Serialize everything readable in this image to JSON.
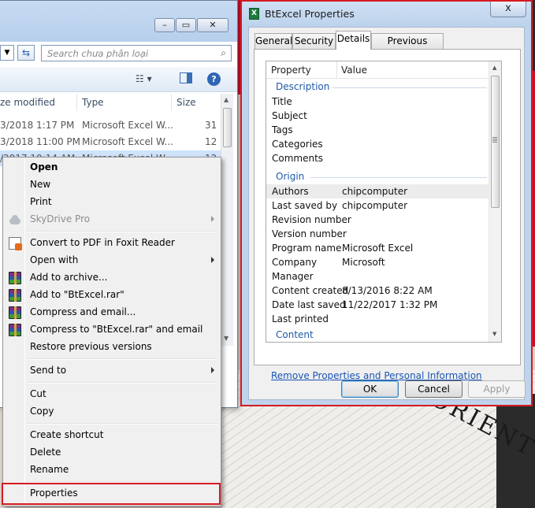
{
  "explorer": {
    "search_placeholder": "Search chưa phân loại",
    "columns": {
      "date": "ze modified",
      "type": "Type",
      "size": "Size"
    },
    "rows": [
      {
        "date": "3/2018 1:17 PM",
        "type": "Microsoft Excel W...",
        "size": "31 I"
      },
      {
        "date": "3/2018 11:00 PM",
        "type": "Microsoft Excel W...",
        "size": "12 I"
      },
      {
        "date": "/2017 10:14 AM",
        "type": "Microsoft Excel W...",
        "size": "12 I"
      }
    ]
  },
  "context_menu": {
    "items": {
      "open": "Open",
      "new": "New",
      "print": "Print",
      "skydrive": "SkyDrive Pro",
      "convert_pdf": "Convert to PDF in Foxit Reader",
      "open_with": "Open with",
      "add_archive": "Add to archive...",
      "add_rar": "Add to \"BtExcel.rar\"",
      "compress_email": "Compress and email...",
      "compress_rar_email": "Compress to \"BtExcel.rar\" and email",
      "restore": "Restore previous versions",
      "send_to": "Send to",
      "cut": "Cut",
      "copy": "Copy",
      "create_shortcut": "Create shortcut",
      "delete": "Delete",
      "rename": "Rename",
      "properties": "Properties"
    }
  },
  "dialog": {
    "title": "BtExcel Properties",
    "close": "x",
    "tabs": [
      "General",
      "Security",
      "Details",
      "Previous Versions"
    ],
    "active_tab": "Details",
    "list_header": {
      "property": "Property",
      "value": "Value"
    },
    "groups": {
      "description": "Description",
      "origin": "Origin",
      "content": "Content"
    },
    "description_rows": [
      {
        "k": "Title",
        "v": ""
      },
      {
        "k": "Subject",
        "v": ""
      },
      {
        "k": "Tags",
        "v": ""
      },
      {
        "k": "Categories",
        "v": ""
      },
      {
        "k": "Comments",
        "v": ""
      }
    ],
    "origin_rows": [
      {
        "k": "Authors",
        "v": "chipcomputer"
      },
      {
        "k": "Last saved by",
        "v": "chipcomputer"
      },
      {
        "k": "Revision number",
        "v": ""
      },
      {
        "k": "Version number",
        "v": ""
      },
      {
        "k": "Program name",
        "v": "Microsoft Excel"
      },
      {
        "k": "Company",
        "v": "Microsoft"
      },
      {
        "k": "Manager",
        "v": ""
      },
      {
        "k": "Content created",
        "v": "8/13/2016 8:22 AM"
      },
      {
        "k": "Date last saved",
        "v": "11/22/2017 1:32 PM"
      },
      {
        "k": "Last printed",
        "v": ""
      }
    ],
    "remove_link": "Remove Properties and Personal Information",
    "buttons": {
      "ok": "OK",
      "cancel": "Cancel",
      "apply": "Apply"
    }
  },
  "wallpaper_text": {
    "word": "ORIENT"
  },
  "colors": {
    "highlight": "#d71920",
    "link": "#1a55b4",
    "group_heading": "#1e5aa8"
  }
}
